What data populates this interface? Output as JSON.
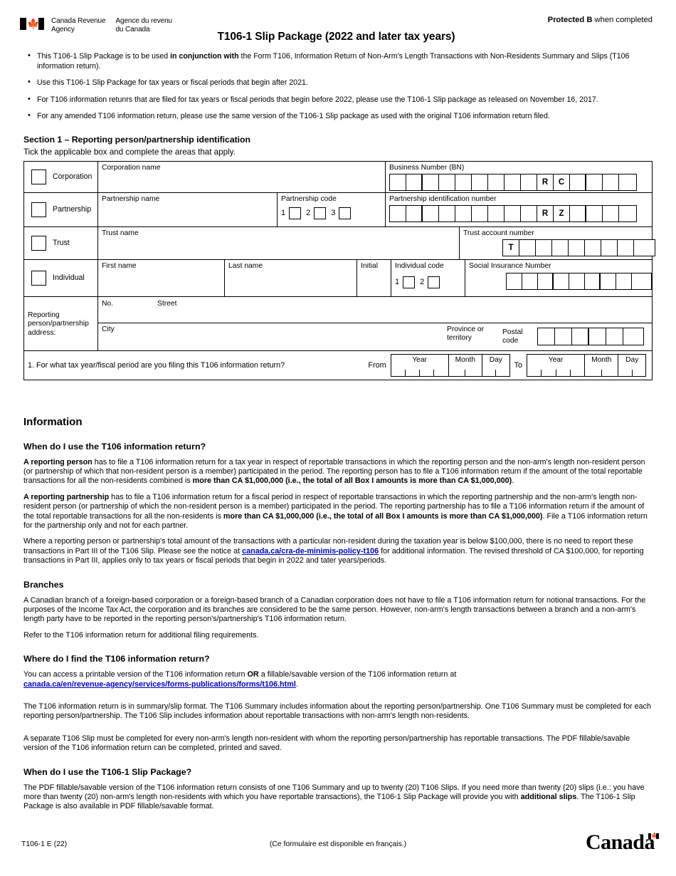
{
  "header": {
    "agency_en": "Canada Revenue\nAgency",
    "agency_fr": "Agence du revenu\ndu Canada",
    "form_title": "T106-1 Slip Package (2022 and later tax years)",
    "protected_bold": "Protected B",
    "protected_rest": " when completed",
    "flag_icon": "canada-flag-icon"
  },
  "bullets": [
    {
      "parts": [
        {
          "t": "This T106-1 Slip Package is to be used ",
          "b": false
        },
        {
          "t": "in conjunction with",
          "b": true
        },
        {
          "t": " the Form T106, Information Return of Non-Arm's Length Transactions with Non-Residents Summary and Slips (T106 information return).",
          "b": false
        }
      ]
    },
    {
      "parts": [
        {
          "t": "Use this T106-1 Slip Package for tax years or fiscal periods that begin after 2021.",
          "b": false
        }
      ]
    },
    {
      "parts": [
        {
          "t": "For T106 information retunrs that are filed for tax years or fiscal periods that begin before 2022, please use the T106-1 Slip package as released on November 16, 2017.",
          "b": false
        }
      ]
    },
    {
      "parts": [
        {
          "t": "For any amended T106 information return, please use the same version of the T106-1 Slip package as used with the original T106 information return filed.",
          "b": false
        }
      ]
    }
  ],
  "section1": {
    "heading": "Section 1 – Reporting person/partnership identification",
    "subheading": "Tick the applicable box and complete the areas that apply.",
    "rows": {
      "corporation": {
        "tick_label": "Corporation",
        "name_label": "Corporation name",
        "bn_label": "Business Number (BN)",
        "bn_prefill": [
          "R",
          "C"
        ],
        "bn_lead_boxes": 9,
        "bn_trail_boxes": 4
      },
      "partnership": {
        "tick_label": "Partnership",
        "name_label": "Partnership name",
        "code_label": "Partnership code",
        "code_options": [
          "1",
          "2",
          "3"
        ],
        "pin_label": "Partnership identification number",
        "pin_prefill": [
          "R",
          "Z"
        ],
        "pin_lead_boxes": 9,
        "pin_trail_boxes": 4
      },
      "trust": {
        "tick_label": "Trust",
        "name_label": "Trust name",
        "account_label": "Trust account number",
        "account_prefill": "T",
        "account_boxes": 8
      },
      "individual": {
        "tick_label": "Individual",
        "first_name_label": "First name",
        "last_name_label": "Last name",
        "initial_label": "Initial",
        "code_label": "Individual code",
        "code_options": [
          "1",
          "2"
        ],
        "sin_label": "Social Insurance Number",
        "sin_boxes": 9
      },
      "address": {
        "side_label": "Reporting person/partnership address:",
        "no_label": "No.",
        "street_label": "Street",
        "city_label": "City",
        "province_label": "Province or territory",
        "postal_label": "Postal code",
        "postal_boxes": 6
      },
      "period": {
        "question": "1.  For what tax year/fiscal period are you filing this T106 information return?",
        "from_label": "From",
        "to_label": "To",
        "year_label": "Year",
        "month_label": "Month",
        "day_label": "Day"
      }
    }
  },
  "information": {
    "title": "Information",
    "q1": {
      "heading": "When do I use the T106 information return?",
      "p1": [
        {
          "t": "A reporting person",
          "b": true
        },
        {
          "t": " has to file a T106 information return for a tax year in respect of reportable transactions in which the reporting person and the non-arm's length non-resident person (or partnership of which that non-resident person is a member) participated in the period. The reporting person has to file a T106 information return if the amount of the total reportable transactions for all the non-residents combined is ",
          "b": false
        },
        {
          "t": "more than CA $1,000,000 (i.e., the total of all Box I amounts is more than CA $1,000,000)",
          "b": true
        },
        {
          "t": ".",
          "b": false
        }
      ],
      "p2": [
        {
          "t": "A reporting partnership",
          "b": true
        },
        {
          "t": " has to file a T106 information return for a fiscal period in respect of reportable transactions in which the reporting partnership and the non-arm's length non-resident person (or partnership of which the non-resident person is a member) participated in the period. The reporting partnership has to file a T106 information return if the amount of the total reportable transactions for all the non-residents is ",
          "b": false
        },
        {
          "t": "more than CA $1,000,000 (i.e., the total of all Box I amounts is more than CA $1,000,000)",
          "b": true
        },
        {
          "t": ". File a T106 information return for the partnership only and not for each partner.",
          "b": false
        }
      ],
      "p3_before": "Where a reporting person or partnership's total amount of the transactions with a particular non-resident during the taxation year is below $100,000, there is no need to report these transactions in Part III of the T106 Slip. Please see the notice at ",
      "p3_link": "canada.ca/cra-de-minimis-policy-t106",
      "p3_after": " for additional information. The revised threshold of CA $100,000, for reporting transactions in Part III, applies only to tax years or fiscal periods that begin in 2022 and tater years/periods."
    },
    "branches": {
      "heading": "Branches",
      "p1": "A Canadian branch of a foreign-based corporation or a foreign-based branch of a Canadian corporation does not have to file a T106 information return for notional transactions. For the purposes of the Income Tax Act, the corporation and its branches are considered to be the same person. However, non-arm's length transactions between a branch and a non-arm's length party have to be reported in the reporting person's/partnership's T106 information return.",
      "p2": "Refer to the T106 information return for additional filing requirements."
    },
    "q2": {
      "heading_before": "Where do I find the ",
      "heading_bold": "T106 information return?",
      "p1_before": "You can access a printable version of the T106 information return ",
      "p1_or": "OR",
      "p1_mid": " a fillable/savable version of the T106 information return at ",
      "p1_link": "canada.ca/en/revenue-agency/services/forms-publications/forms/t106.html",
      "p1_after": ".",
      "p2": "The T106 information return is in summary/slip format. The T106 Summary includes information about the reporting person/partnership. One T106 Summary must be completed for each reporting person/partnership. The T106 Slip includes information about reportable transactions with non-arm's length non-residents.",
      "p3": "A separate T106 Slip must be completed for every non-arm's length non-resident with whom the reporting person/partnership has reportable transactions. The PDF fillable/savable version of the T106 information return can be completed, printed and saved."
    },
    "q3": {
      "heading": "When do I use the T106-1 Slip Package?",
      "p1": [
        {
          "t": "The PDF fillable/savable version of the T106 information return consists of one T106 Summary and up to twenty (20) T106 Slips. If you need more than twenty (20) slips (i.e.: you have more than twenty (20) non-arm's length non-residents with which you have reportable transactions), the T106-1 Slip Package will provide you with ",
          "b": false
        },
        {
          "t": "additional slips",
          "b": true
        },
        {
          "t": ". The T106-1 Slip Package is also available in PDF fillable/savable format.",
          "b": false
        }
      ]
    }
  },
  "footer": {
    "form_code": "T106-1 E (22)",
    "french_note": "(Ce formulaire est disponible en français.)",
    "wordmark": "Canada"
  }
}
